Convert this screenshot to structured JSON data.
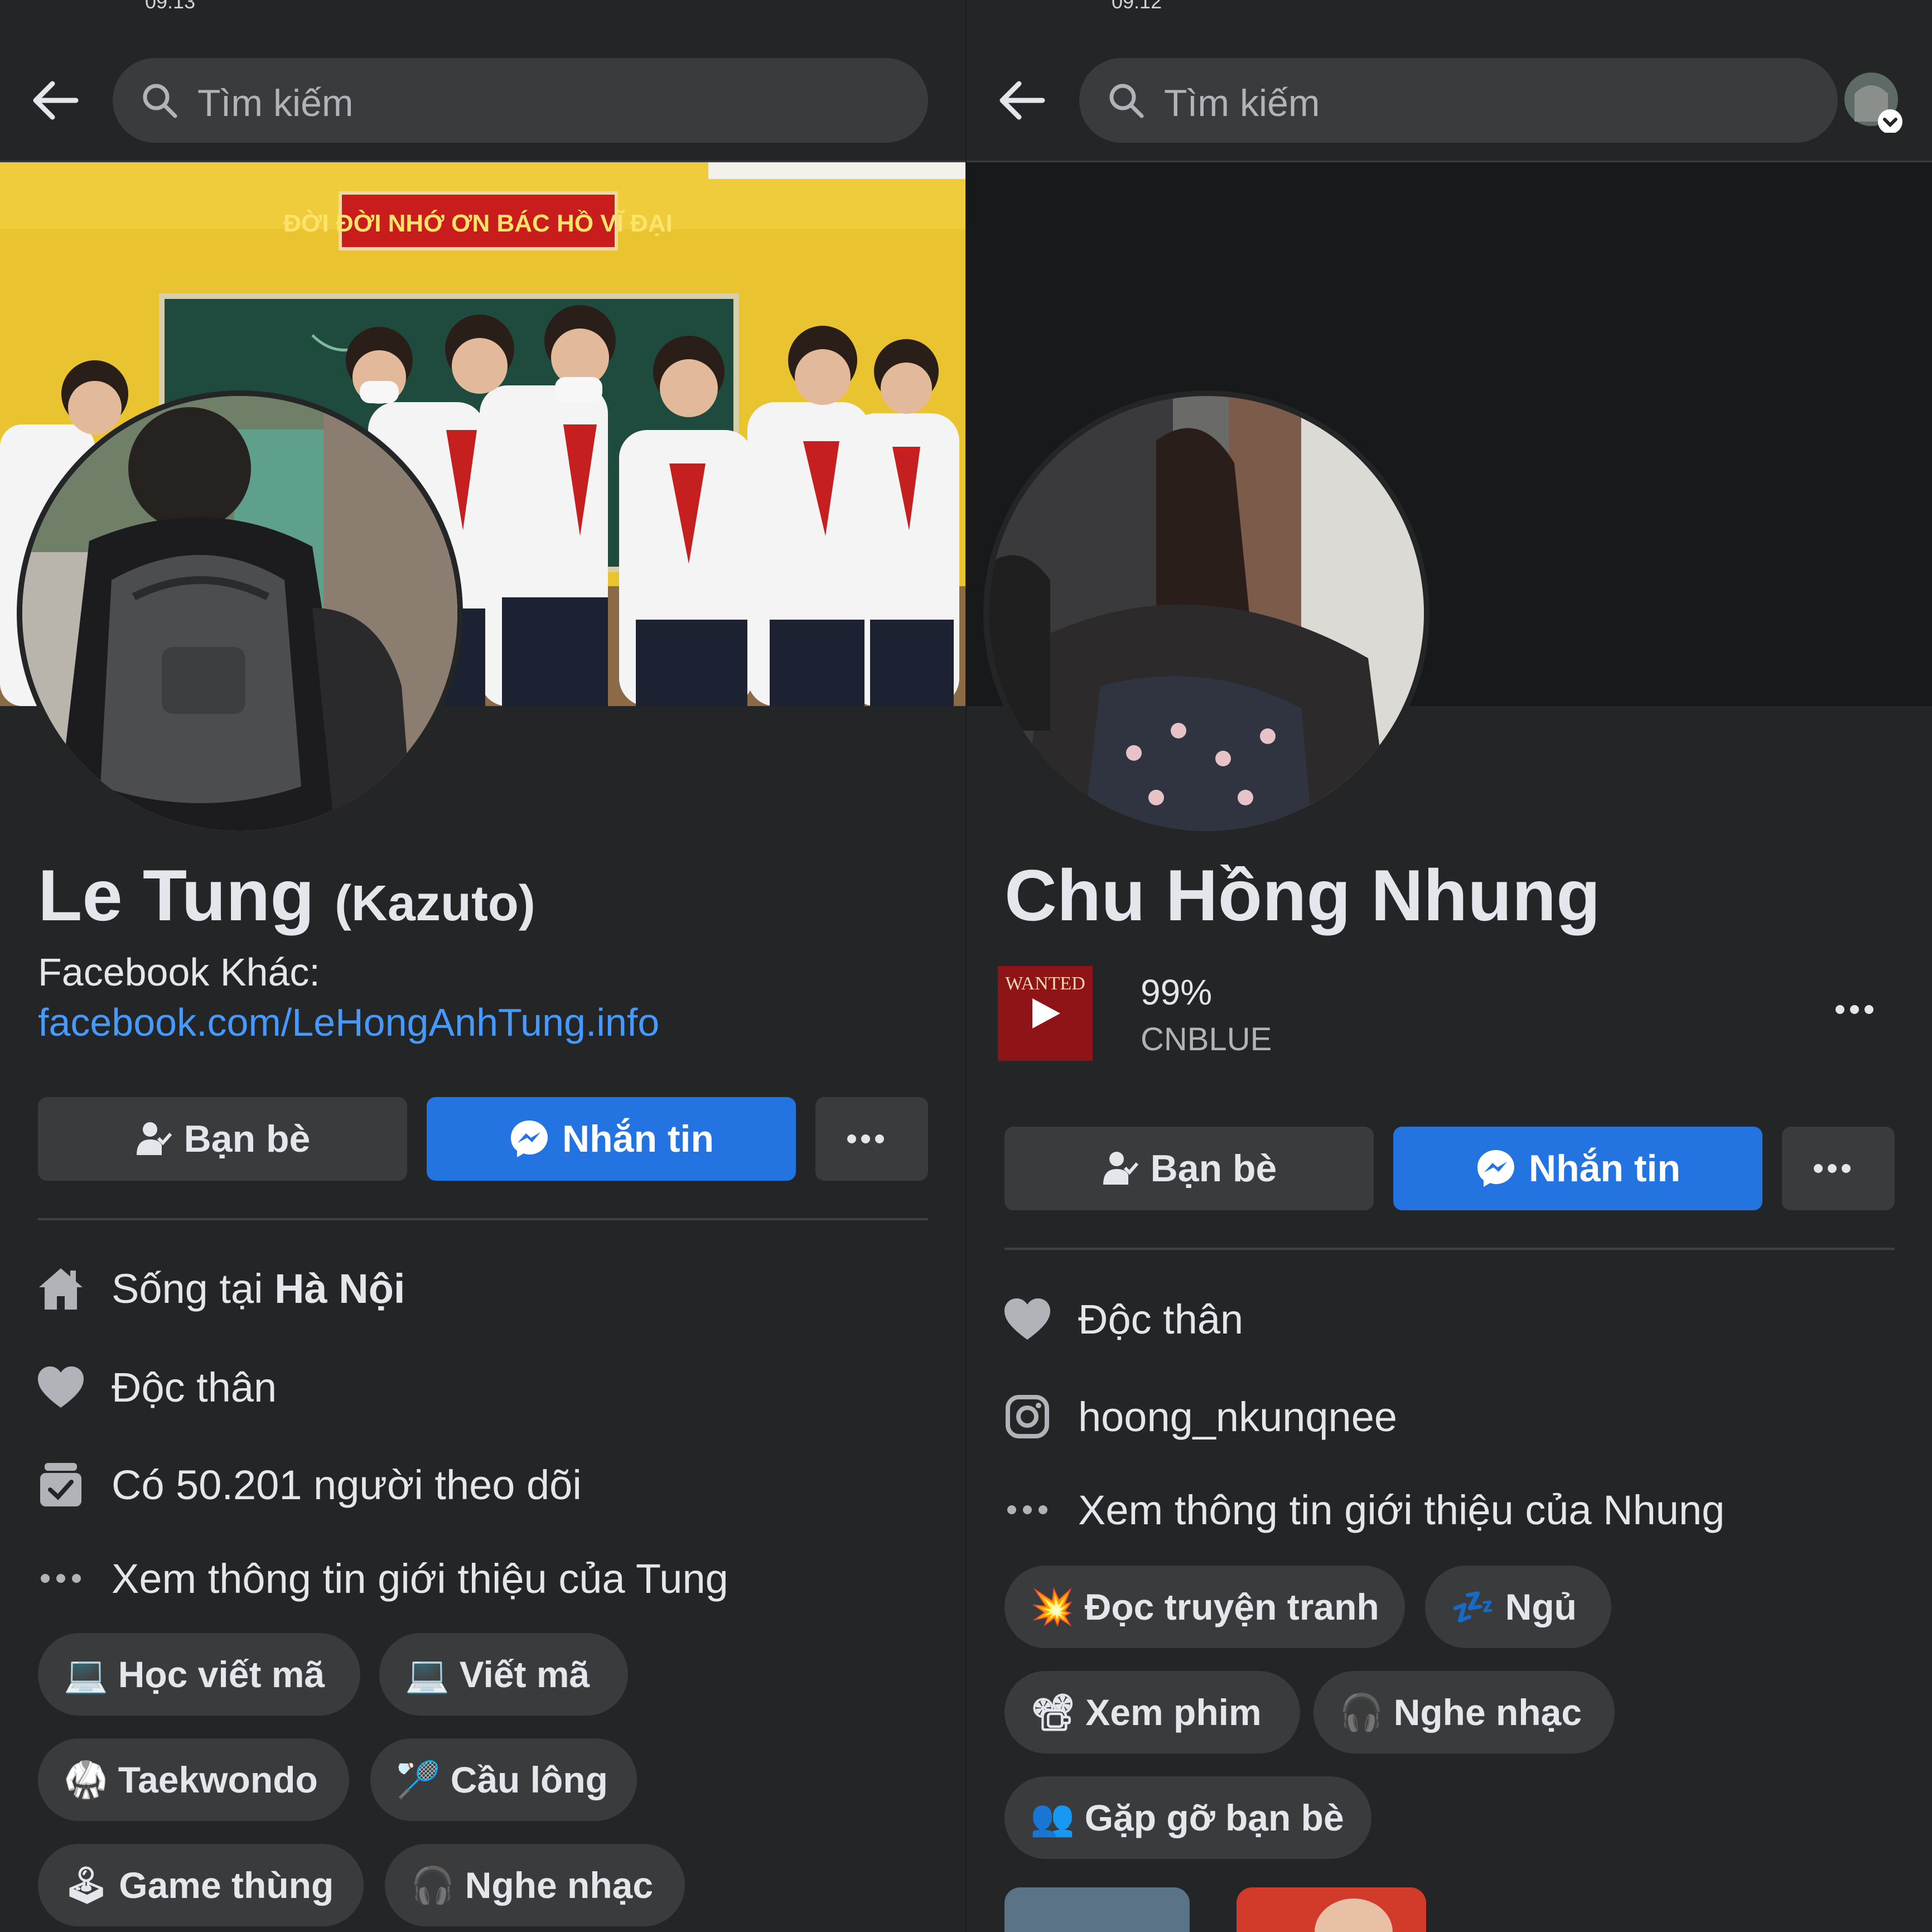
{
  "search_placeholder": "Tìm kiếm",
  "left_profile": {
    "status_time": "09:13",
    "name": "Le Tung",
    "nickname": "(Kazuto)",
    "bio_line1": "Facebook Khác:",
    "bio_link": "facebook.com/LeHongAnhTung.info",
    "cover_banner": "ĐỜI ĐỜI NHỚ ƠN BÁC HỒ VĨ ĐẠI",
    "buttons": {
      "friends": "Bạn bè",
      "message": "Nhắn tin"
    },
    "info": {
      "lives_prefix": "Sống tại",
      "lives_city": "Hà Nội",
      "relationship": "Độc thân",
      "followers": "Có 50.201 người theo dõi",
      "about": "Xem thông tin giới thiệu của Tung"
    },
    "hobbies": [
      {
        "icon": "laptop-icon",
        "label": "Học viết mã"
      },
      {
        "icon": "laptop-icon",
        "label": "Viết mã"
      },
      {
        "icon": "martial-arts-uniform-icon",
        "label": "Taekwondo"
      },
      {
        "icon": "badminton-icon",
        "label": "Cầu lông"
      },
      {
        "icon": "joystick-icon",
        "label": "Game thùng"
      },
      {
        "icon": "headphones-icon",
        "label": "Nghe nhạc"
      }
    ]
  },
  "right_profile": {
    "status_time": "09:12",
    "name": "Chu Hồng Nhung",
    "music": {
      "title": "99%",
      "artist": "CNBLUE",
      "cover_text": "WANTED"
    },
    "buttons": {
      "friends": "Bạn bè",
      "message": "Nhắn tin"
    },
    "info": {
      "relationship": "Độc thân",
      "instagram": "hoong_nkunqnee",
      "about": "Xem thông tin giới thiệu của Nhung"
    },
    "hobbies": [
      {
        "icon": "explosion-icon",
        "label": "Đọc truyện tranh"
      },
      {
        "icon": "sleep-icon",
        "label": "Ngủ"
      },
      {
        "icon": "film-projector-icon",
        "label": "Xem phim"
      },
      {
        "icon": "headphones-icon",
        "label": "Nghe nhạc"
      },
      {
        "icon": "people-icon",
        "label": "Gặp gỡ bạn bè"
      }
    ]
  },
  "colors": {
    "background": "#242526",
    "surface": "#3a3b3c",
    "accent": "#2374e1",
    "link": "#4599ff",
    "text": "#e4e6eb",
    "muted": "#b0b3b8"
  }
}
